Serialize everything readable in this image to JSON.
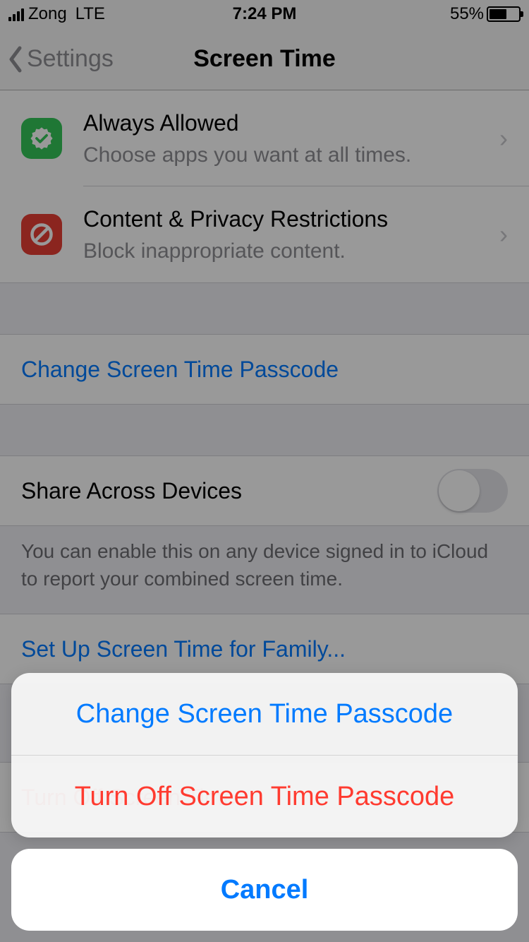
{
  "status_bar": {
    "carrier": "Zong",
    "network": "LTE",
    "time": "7:24 PM",
    "battery_pct": "55%"
  },
  "nav": {
    "back_label": "Settings",
    "title": "Screen Time"
  },
  "rows": {
    "always_allowed": {
      "icon": "badge-check-icon",
      "title": "Always Allowed",
      "subtitle": "Choose apps you want at all times."
    },
    "content_restrictions": {
      "icon": "no-entry-icon",
      "title": "Content & Privacy Restrictions",
      "subtitle": "Block inappropriate content."
    },
    "change_passcode": {
      "label": "Change Screen Time Passcode"
    },
    "share_devices": {
      "label": "Share Across Devices",
      "enabled": false
    },
    "share_footer": "You can enable this on any device signed in to iCloud to report your combined screen time.",
    "family": {
      "label": "Set Up Screen Time for Family..."
    },
    "turn_off": {
      "label": "Turn Off Screen Time..."
    }
  },
  "action_sheet": {
    "options": [
      {
        "label": "Change Screen Time Passcode",
        "style": "blue"
      },
      {
        "label": "Turn Off Screen Time Passcode",
        "style": "red"
      }
    ],
    "cancel": "Cancel"
  },
  "colors": {
    "link": "#007aff",
    "destructive": "#ff3b30"
  }
}
